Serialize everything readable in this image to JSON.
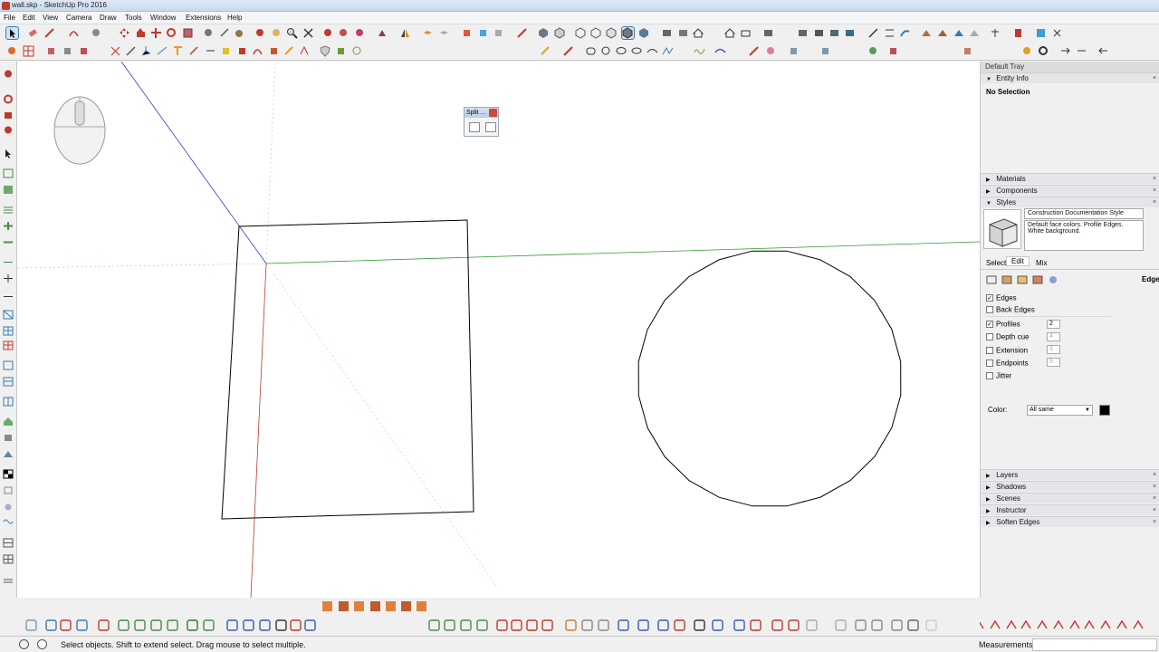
{
  "window": {
    "title": "wall.skp - SketchUp Pro 2016"
  },
  "menu": [
    "File",
    "Edit",
    "View",
    "Camera",
    "Draw",
    "Tools",
    "Window",
    "Extensions",
    "Help"
  ],
  "split_panel": {
    "title": "Split ..."
  },
  "tray": {
    "title": "Default Tray",
    "entity_info": {
      "header": "Entity Info",
      "selection": "No Selection"
    },
    "sections_top": [
      "Materials",
      "Components",
      "Styles"
    ],
    "style": {
      "name": "Construction Documentation Style",
      "description": "Default face colors. Profile Edges. White background."
    },
    "tabs": [
      "Select",
      "Edit",
      "Mix"
    ],
    "active_tab": "Edit",
    "edit_label": "Edge",
    "options": [
      {
        "label": "Edges",
        "checked": true,
        "value": ""
      },
      {
        "label": "Back Edges",
        "checked": false,
        "value": ""
      },
      {
        "label": "Profiles",
        "checked": true,
        "value": "2"
      },
      {
        "label": "Depth cue",
        "checked": false,
        "value": "4"
      },
      {
        "label": "Extension",
        "checked": false,
        "value": "3"
      },
      {
        "label": "Endpoints",
        "checked": false,
        "value": "9"
      },
      {
        "label": "Jitter",
        "checked": false,
        "value": ""
      }
    ],
    "color_label": "Color:",
    "color_select": "All same",
    "color_swatch": "#000000",
    "sections_bottom": [
      "Layers",
      "Shadows",
      "Scenes",
      "Instructor",
      "Soften Edges"
    ]
  },
  "status": {
    "hint": "Select objects. Shift to extend select. Drag mouse to select multiple.",
    "measurements_label": "Measurements"
  },
  "colors": {
    "axis_red": "#c0392b",
    "axis_green": "#2e9b2e",
    "axis_blue": "#2d3ec9",
    "accent_select": "#3c7fb1"
  }
}
